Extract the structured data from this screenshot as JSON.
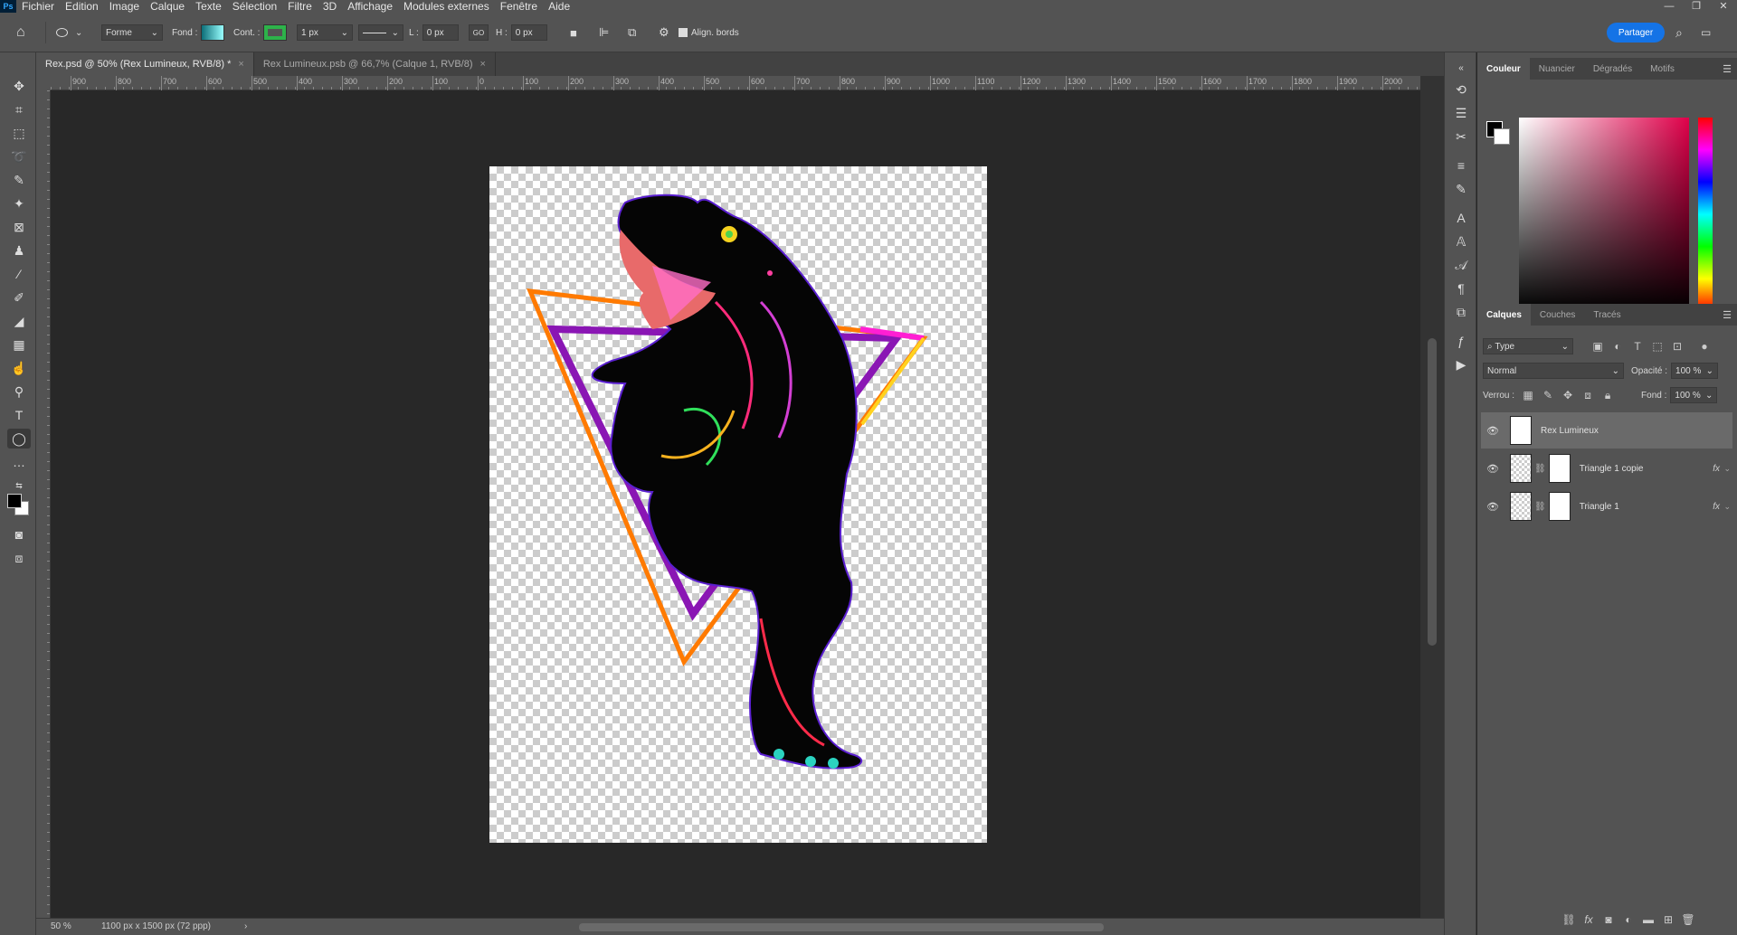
{
  "app": {
    "logo": "Ps"
  },
  "menu": [
    "Fichier",
    "Edition",
    "Image",
    "Calque",
    "Texte",
    "Sélection",
    "Filtre",
    "3D",
    "Affichage",
    "Modules externes",
    "Fenêtre",
    "Aide"
  ],
  "window_controls": {
    "minimize": "—",
    "restore": "❐",
    "close": "✕"
  },
  "options": {
    "shape_mode": "Forme",
    "fill_label": "Fond :",
    "stroke_label": "Cont. :",
    "stroke_width": "1 px",
    "w_label": "L :",
    "w_value": "0 px",
    "link_label": "GO",
    "h_label": "H :",
    "h_value": "0 px",
    "align_edges": "Align. bords",
    "share": "Partager"
  },
  "tabs": [
    {
      "label": "Rex.psd @ 50% (Rex Lumineux, RVB/8) *",
      "close": "×"
    },
    {
      "label": "Rex Lumineux.psb @ 66,7% (Calque 1, RVB/8)",
      "close": "×"
    }
  ],
  "ruler_labels": [
    "900",
    "800",
    "700",
    "600",
    "500",
    "400",
    "300",
    "200",
    "100",
    "0",
    "100",
    "200",
    "300",
    "400",
    "500",
    "600",
    "700",
    "800",
    "900",
    "1000",
    "1100",
    "1200",
    "1300",
    "1400",
    "1500",
    "1600",
    "1700",
    "1800",
    "1900",
    "2000"
  ],
  "status": {
    "zoom": "50 %",
    "doc_info": "1100 px x 1500 px (72 ppp)",
    "arrow": "›"
  },
  "color_panel": {
    "tabs": [
      "Couleur",
      "Nuancier",
      "Dégradés",
      "Motifs"
    ],
    "active": "Couleur",
    "foreground": "#000000",
    "background": "#ffffff"
  },
  "layers_panel": {
    "tabs": [
      "Calques",
      "Couches",
      "Tracés"
    ],
    "filter": "Type",
    "blend_mode": "Normal",
    "opacity_label": "Opacité :",
    "opacity_value": "100 %",
    "lock_label": "Verrou :",
    "fill_label": "Fond :",
    "fill_value": "100 %",
    "layers": [
      {
        "name": "Rex Lumineux",
        "selected": true,
        "fx": ""
      },
      {
        "name": "Triangle 1 copie",
        "selected": false,
        "fx": "fx"
      },
      {
        "name": "Triangle 1",
        "selected": false,
        "fx": "fx"
      }
    ],
    "footer_icons": [
      "link-icon",
      "fx-icon",
      "mask-icon",
      "adjustment-icon",
      "folder-icon",
      "new-layer-icon",
      "trash-icon"
    ]
  },
  "colors": {
    "accent": "#1473e6",
    "panel_bg": "#535353",
    "workspace_bg": "#282828"
  }
}
